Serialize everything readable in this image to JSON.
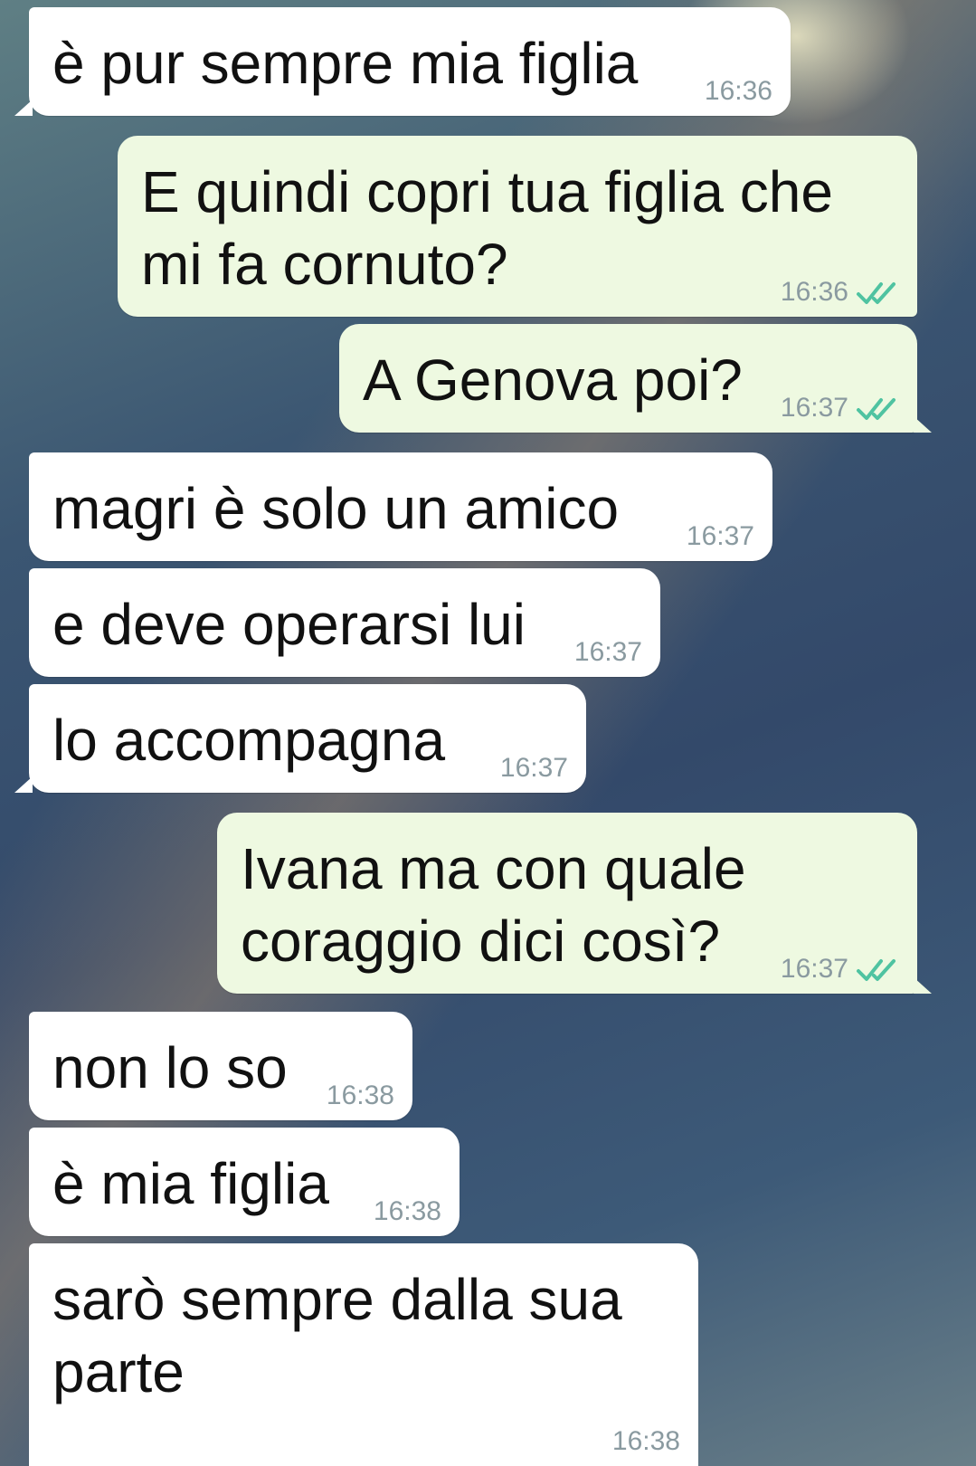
{
  "messages": [
    {
      "dir": "in",
      "text": "è pur sempre mia figlia",
      "time": "16:36"
    },
    {
      "dir": "out",
      "text": "E quindi copri tua figlia che mi fa cornuto?",
      "time": "16:36",
      "status": "read"
    },
    {
      "dir": "out",
      "text": "A Genova poi?",
      "time": "16:37",
      "status": "read"
    },
    {
      "dir": "in",
      "text": "magri è solo un amico",
      "time": "16:37"
    },
    {
      "dir": "in",
      "text": "e deve operarsi lui",
      "time": "16:37"
    },
    {
      "dir": "in",
      "text": "lo accompagna",
      "time": "16:37"
    },
    {
      "dir": "out",
      "text": "Ivana ma con quale coraggio dici così?",
      "time": "16:37",
      "status": "read"
    },
    {
      "dir": "in",
      "text": "non lo so",
      "time": "16:38"
    },
    {
      "dir": "in",
      "text": "è mia figlia",
      "time": "16:38"
    },
    {
      "dir": "in",
      "text": "sarò sempre dalla sua parte",
      "time": "16:38"
    }
  ],
  "colors": {
    "incoming_bubble": "#ffffff",
    "outgoing_bubble": "#eef9e1",
    "read_ticks": "#4fc3a1",
    "timestamp": "#8a9aa0"
  },
  "icons": {
    "read_status": "double-check-icon"
  }
}
